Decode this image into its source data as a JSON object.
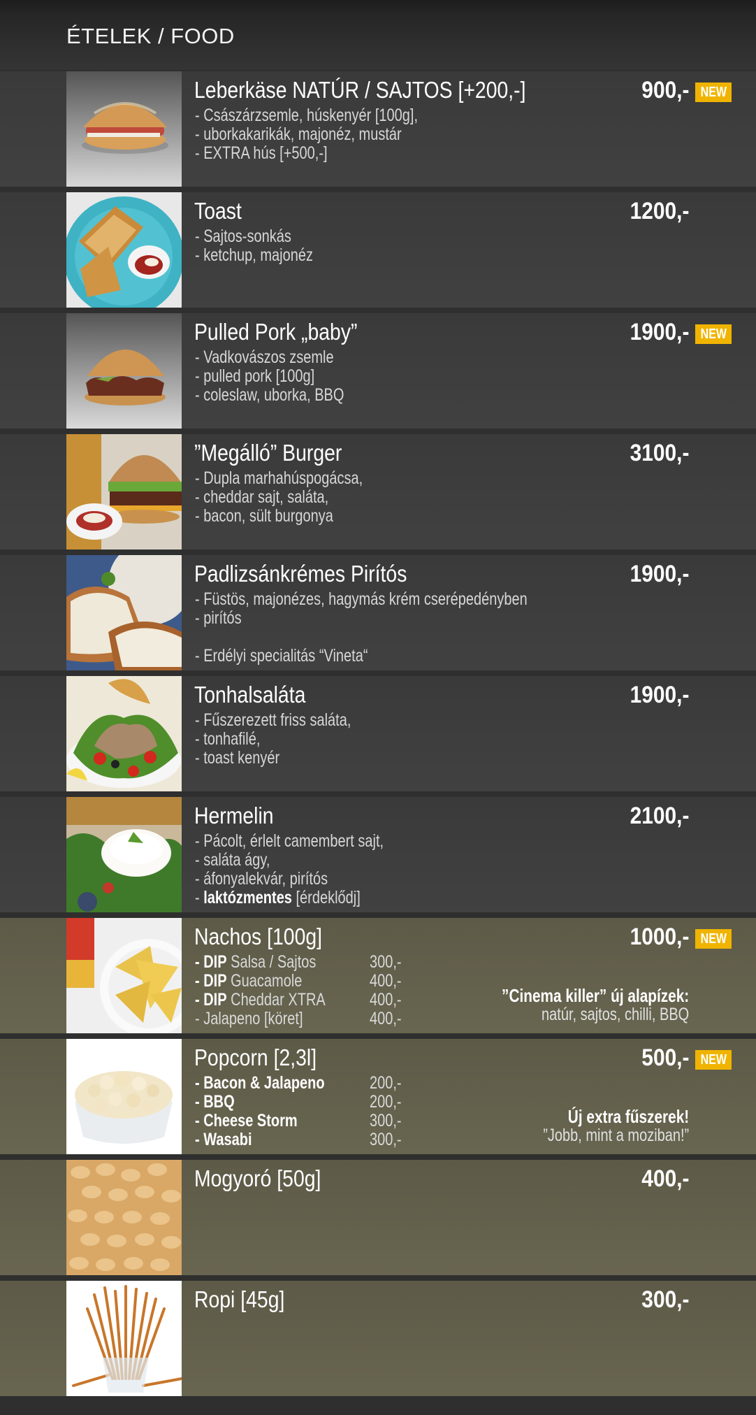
{
  "page_title": "ÉTELEK / FOOD",
  "colors": {
    "badge": "#f0b400",
    "dark_row": "#3d3d3d",
    "olive_row": "#635f4b"
  },
  "items": [
    {
      "name": "Leberkäse  NATÚR / SAJTOS [+200,-]",
      "price": "900,-",
      "badge": "NEW",
      "desc": [
        "- Császárzsemle, húskenyér [100g],",
        "- uborkakarikák, majonéz, mustár",
        "- EXTRA hús [+500,-]"
      ]
    },
    {
      "name": "Toast",
      "price": "1200,-",
      "desc": [
        "- Sajtos-sonkás",
        "- ketchup, majonéz"
      ]
    },
    {
      "name": "Pulled Pork „baby”",
      "price": "1900,-",
      "badge": "NEW",
      "desc": [
        "- Vadkovászos zsemle",
        "- pulled pork [100g]",
        "- coleslaw, uborka, BBQ"
      ]
    },
    {
      "name": "”Megálló” Burger",
      "price": "3100,-",
      "desc": [
        "- Dupla marhahúspogácsa,",
        "- cheddar sajt, saláta,",
        "- bacon, sült burgonya"
      ]
    },
    {
      "name": "Padlizsánkrémes Pirítós",
      "price": "1900,-",
      "desc": [
        "- Füstös, majonézes, hagymás krém cserépedényben",
        "- pirítós",
        "",
        "- Erdélyi specialitás “Vineta“"
      ]
    },
    {
      "name": "Tonhalsaláta",
      "price": "1900,-",
      "desc": [
        "- Fűszerezett friss saláta,",
        "- tonhafilé,",
        "- toast kenyér"
      ]
    },
    {
      "name": "Hermelin",
      "price": "2100,-",
      "desc": [
        "- Pácolt, érlelt camembert sajt,",
        "- saláta ágy,",
        "- áfonyalekvár, pirítós"
      ],
      "desc_bold_prefix": "- ",
      "desc_bold": "laktózmentes",
      "desc_bold_suffix": " [érdeklődj]"
    },
    {
      "name": "Nachos [100g]",
      "price": "1000,-",
      "badge": "NEW",
      "options": [
        {
          "bold": "- DIP",
          "label": " Salsa / Sajtos",
          "price": "300,-"
        },
        {
          "bold": "- DIP",
          "label": " Guacamole",
          "price": "400,-"
        },
        {
          "bold": "- DIP",
          "label": " Cheddar XTRA",
          "price": "400,-"
        },
        {
          "bold": "",
          "label": "- Jalapeno [köret]",
          "price": "400,-"
        }
      ],
      "promo_title": "”Cinema killer” új alapízek:",
      "promo_sub": "natúr, sajtos, chilli, BBQ"
    },
    {
      "name": "Popcorn [2,3l]",
      "price": "500,-",
      "badge": "NEW",
      "options": [
        {
          "bold": "- Bacon & Jalapeno",
          "label": "",
          "price": "200,-"
        },
        {
          "bold": "- BBQ",
          "label": "",
          "price": "200,-"
        },
        {
          "bold": "- Cheese Storm",
          "label": "",
          "price": "300,-"
        },
        {
          "bold": "- Wasabi",
          "label": "",
          "price": "300,-"
        }
      ],
      "promo_title": "Új extra fűszerek!",
      "promo_sub": "”Jobb, mint a moziban!”"
    },
    {
      "name": "Mogyoró [50g]",
      "price": "400,-"
    },
    {
      "name": "Ropi [45g]",
      "price": "300,-"
    }
  ]
}
